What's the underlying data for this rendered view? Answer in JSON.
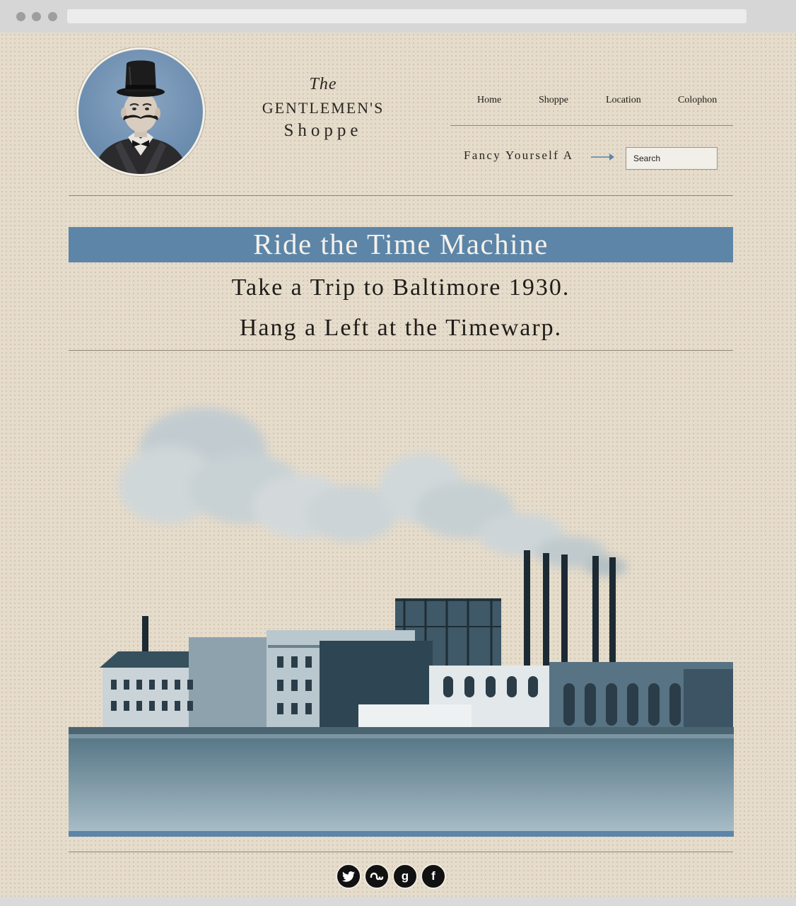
{
  "brand": {
    "the": "The",
    "name_line1": "GENTLEMEN'S",
    "name_line2": "Shoppe"
  },
  "nav": {
    "items": [
      {
        "label": "Home"
      },
      {
        "label": "Shoppe"
      },
      {
        "label": "Location"
      },
      {
        "label": "Colophon"
      }
    ]
  },
  "search": {
    "prompt": "Fancy Yourself A",
    "placeholder": "Search"
  },
  "hero": {
    "banner": "Ride the Time Machine",
    "line1": "Take a Trip to Baltimore 1930.",
    "line2": "Hang a Left at the Timewarp."
  },
  "social": {
    "items": [
      "twitter-icon",
      "stumbleupon-icon",
      "google-icon",
      "facebook-icon"
    ],
    "colors": {
      "icon_bg": "#111111",
      "ring": "#f1ebe0"
    }
  },
  "colors": {
    "page_bg": "#e6dccb",
    "accent_blue": "#5c85a8",
    "text": "#1f1c19"
  }
}
